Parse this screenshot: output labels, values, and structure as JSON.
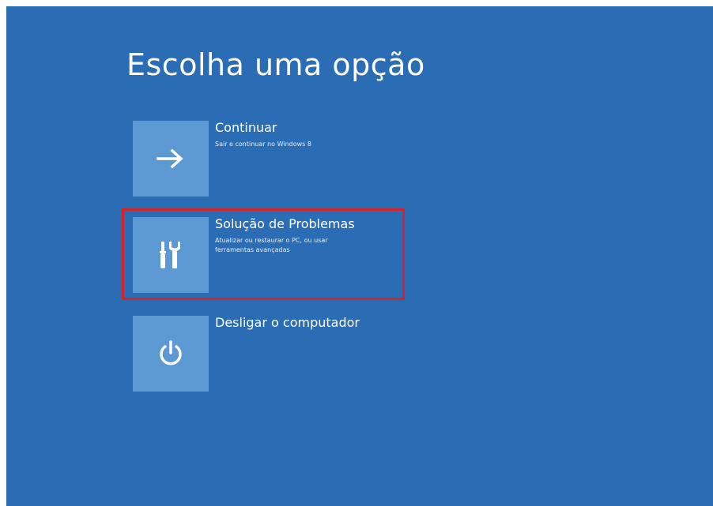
{
  "screen": {
    "title": "Escolha uma opção"
  },
  "options": [
    {
      "label": "Continuar",
      "description": "Sair e continuar no Windows 8",
      "icon": "arrow-right-icon"
    },
    {
      "label": "Solução de Problemas",
      "description": "Atualizar ou restaurar o PC, ou usar ferramentas avançadas",
      "icon": "tools-icon"
    },
    {
      "label": "Desligar o computador",
      "description": "",
      "icon": "power-icon"
    }
  ],
  "colors": {
    "background": "#2a6db4",
    "tile": "#5c98d2",
    "highlight": "#d6232a",
    "text": "#ffffff"
  }
}
